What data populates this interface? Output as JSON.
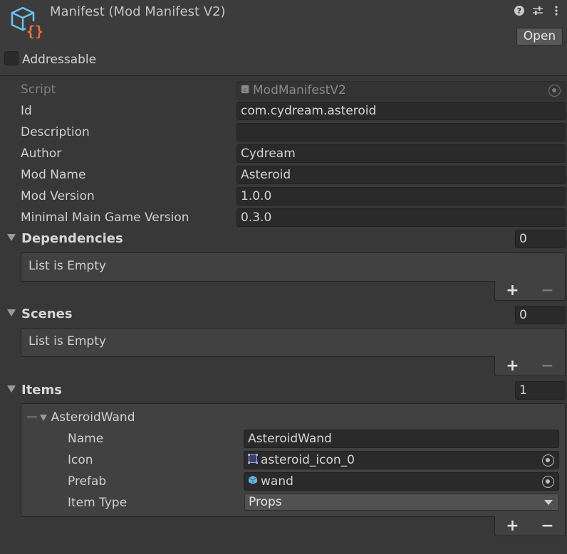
{
  "header": {
    "title": "Manifest (Mod Manifest V2)",
    "open_label": "Open",
    "addressable_label": "Addressable",
    "addressable_checked": false,
    "icons": [
      "asset-cube-icon",
      "help-icon",
      "settings-sliders-icon",
      "more-vert-icon"
    ]
  },
  "fields": {
    "script_label": "Script",
    "script_value": "ModManifestV2",
    "id_label": "Id",
    "id_value": "com.cydream.asteroid",
    "description_label": "Description",
    "description_value": "",
    "author_label": "Author",
    "author_value": "Cydream",
    "mod_name_label": "Mod Name",
    "mod_name_value": "Asteroid",
    "mod_version_label": "Mod Version",
    "mod_version_value": "1.0.0",
    "min_game_label": "Minimal Main Game Version",
    "min_game_value": "0.3.0"
  },
  "dependencies": {
    "label": "Dependencies",
    "count": "0",
    "empty_text": "List is Empty",
    "add": "+",
    "remove": "−"
  },
  "scenes": {
    "label": "Scenes",
    "count": "0",
    "empty_text": "List is Empty",
    "add": "+",
    "remove": "−"
  },
  "items": {
    "label": "Items",
    "count": "1",
    "add": "+",
    "remove": "−",
    "element": {
      "header": "AsteroidWand",
      "name_label": "Name",
      "name_value": "AsteroidWand",
      "icon_label": "Icon",
      "icon_value": "asteroid_icon_0",
      "prefab_label": "Prefab",
      "prefab_value": "wand",
      "item_type_label": "Item Type",
      "item_type_value": "Props"
    }
  },
  "colors": {
    "background": "#383838",
    "field": "#2a2a2a",
    "list_box": "#414141",
    "accent_orange": "#e8703a",
    "accent_cyan": "#5fb6e0"
  }
}
